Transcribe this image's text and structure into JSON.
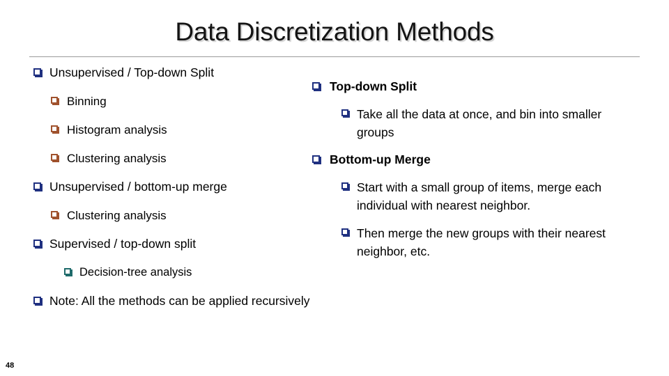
{
  "slide": {
    "title": "Data Discretization Methods",
    "page_number": "48",
    "colors": {
      "bullet_level1": "#1F3080",
      "bullet_level2": "#A0522D",
      "bullet_level3": "#1F6B6B",
      "title_text": "#141414",
      "rule": "#9A9A9A",
      "background": "#FFFFFF"
    }
  },
  "left_column": {
    "items": [
      {
        "level": 1,
        "bullet": "square-bullet-navy",
        "text": "Unsupervised / Top-down Split"
      },
      {
        "level": 2,
        "bullet": "square-bullet-brown",
        "text": "Binning"
      },
      {
        "level": 2,
        "bullet": "square-bullet-brown",
        "text": "Histogram analysis"
      },
      {
        "level": 2,
        "bullet": "square-bullet-brown",
        "text": "Clustering analysis"
      },
      {
        "level": 1,
        "bullet": "square-bullet-navy",
        "text": "Unsupervised / bottom-up merge"
      },
      {
        "level": 2,
        "bullet": "square-bullet-brown",
        "text": "Clustering analysis"
      },
      {
        "level": 1,
        "bullet": "square-bullet-navy",
        "text": "Supervised / top-down split"
      },
      {
        "level": 3,
        "bullet": "square-bullet-teal",
        "text": "Decision-tree analysis"
      },
      {
        "level": 1,
        "bullet": "square-bullet-navy",
        "text": "Note: All the methods can be applied recursively"
      }
    ]
  },
  "right_column": {
    "items": [
      {
        "level": 1,
        "bullet": "square-bullet-navy",
        "text": "Top-down Split"
      },
      {
        "level": 2,
        "bullet": "square-bullet-navy",
        "text": "Take all the data at once, and bin into smaller groups"
      },
      {
        "level": 1,
        "bullet": "square-bullet-navy",
        "text": "Bottom-up Merge"
      },
      {
        "level": 2,
        "bullet": "square-bullet-navy",
        "text": "Start with a small group of items, merge each individual with nearest neighbor."
      },
      {
        "level": 2,
        "bullet": "square-bullet-navy",
        "text": "Then merge the new groups with their nearest neighbor, etc."
      }
    ]
  }
}
